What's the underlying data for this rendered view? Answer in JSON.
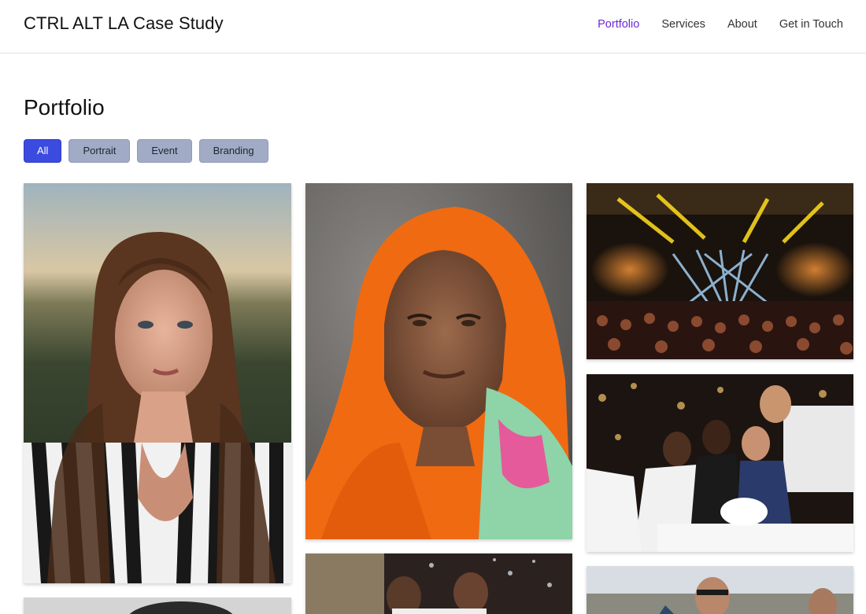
{
  "header": {
    "brand": "CTRL ALT LA Case Study",
    "nav": [
      {
        "label": "Portfolio",
        "active": true
      },
      {
        "label": "Services",
        "active": false
      },
      {
        "label": "About",
        "active": false
      },
      {
        "label": "Get in Touch",
        "active": false
      }
    ]
  },
  "main": {
    "title": "Portfolio",
    "filters": [
      {
        "label": "All",
        "active": true
      },
      {
        "label": "Portrait",
        "active": false
      },
      {
        "label": "Event",
        "active": false
      },
      {
        "label": "Branding",
        "active": false
      }
    ]
  },
  "colors": {
    "accent": "#3b4be0",
    "nav_active": "#6d28d9",
    "filter_inactive": "#a2abc6"
  },
  "gallery": [
    {
      "subject": "portrait of woman in striped shirt at sunset"
    },
    {
      "subject": "portrait of elderly woman in orange headscarf"
    },
    {
      "subject": "concert stage with yellow and blue lights"
    },
    {
      "subject": "group of men celebrating at wedding party"
    },
    {
      "subject": "portrait photo (partially visible)"
    },
    {
      "subject": "wedding couple with bubbles (partially visible)"
    },
    {
      "subject": "men outdoors on terrace (partially visible)"
    }
  ]
}
